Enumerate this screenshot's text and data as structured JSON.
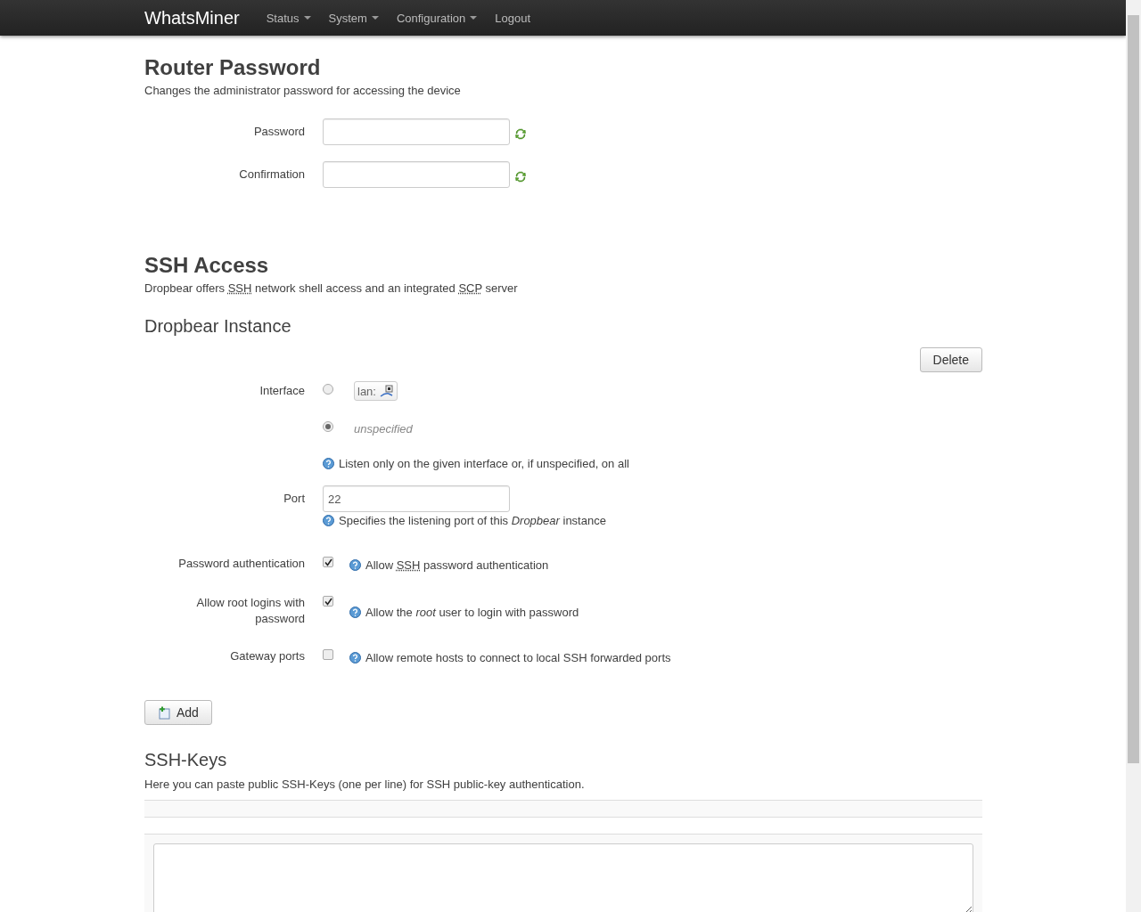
{
  "navbar": {
    "brand": "WhatsMiner",
    "menu": [
      {
        "label": "Status",
        "dropdown": true
      },
      {
        "label": "System",
        "dropdown": true
      },
      {
        "label": "Configuration",
        "dropdown": true
      },
      {
        "label": "Logout",
        "dropdown": false
      }
    ]
  },
  "router_password": {
    "title": "Router Password",
    "description": "Changes the administrator password for accessing the device",
    "fields": [
      {
        "label": "Password"
      },
      {
        "label": "Confirmation"
      }
    ]
  },
  "ssh_access": {
    "title": "SSH Access",
    "description": [
      {
        "text": "Dropbear offers ",
        "kind": "text"
      },
      {
        "text": "SSH",
        "kind": "abbr"
      },
      {
        "text": " network shell access and an integrated ",
        "kind": "text"
      },
      {
        "text": "SCP",
        "kind": "abbr"
      },
      {
        "text": " server",
        "kind": "text"
      }
    ],
    "instance": {
      "title": "Dropbear Instance",
      "delete_button": "Delete",
      "interface": {
        "label": "Interface",
        "options": [
          {
            "kind": "network",
            "label": "lan:",
            "selected": false
          },
          {
            "kind": "unspecified",
            "label": "unspecified",
            "selected": true
          }
        ],
        "help": [
          {
            "text": "Listen only on the given interface or, if unspecified, on all",
            "kind": "text"
          }
        ]
      },
      "port": {
        "label": "Port",
        "value": "22",
        "help": [
          {
            "text": "Specifies the listening port of this *Dropbear* instance",
            "kind": "text"
          }
        ]
      },
      "options": [
        {
          "label": "Password authentication",
          "checked": true,
          "help": [
            {
              "text": "Allow ",
              "kind": "text"
            },
            {
              "text": "SSH",
              "kind": "abbr"
            },
            {
              "text": " password authentication",
              "kind": "text"
            }
          ]
        },
        {
          "label": "Allow root logins with password",
          "checked": true,
          "help": [
            {
              "text": "Allow the *root* user to login with password",
              "kind": "text"
            }
          ]
        },
        {
          "label": "Gateway ports",
          "checked": false,
          "help": [
            {
              "text": "Allow remote hosts to connect to local SSH forwarded ports",
              "kind": "text"
            }
          ]
        }
      ]
    },
    "add_button": "Add"
  },
  "ssh_keys": {
    "title": "SSH-Keys",
    "description": "Here you can paste public SSH-Keys (one per line) for SSH public-key authentication."
  }
}
